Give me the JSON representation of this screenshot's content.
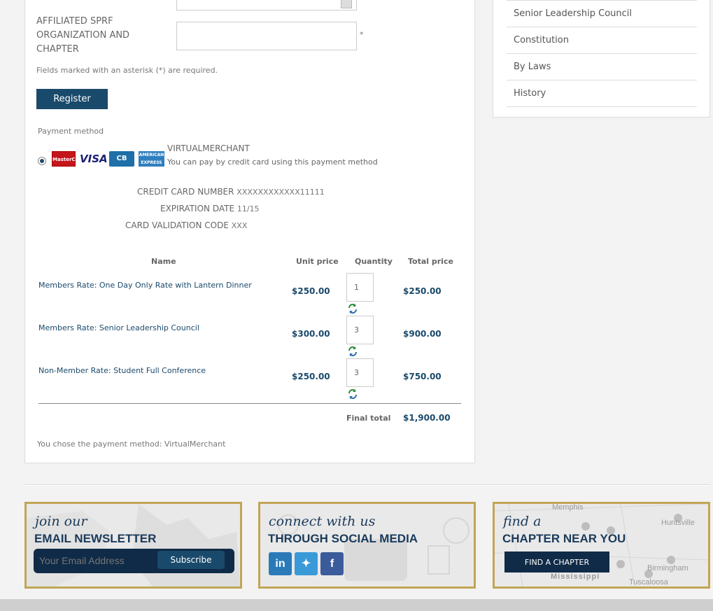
{
  "sidebar": {
    "items": [
      {
        "label": "Senior Leadership Council"
      },
      {
        "label": "Constitution"
      },
      {
        "label": "By Laws"
      },
      {
        "label": "History"
      }
    ]
  },
  "form": {
    "affiliated_label": "AFFILIATED SPRF ORGANIZATION AND CHAPTER",
    "affiliated_value": "",
    "asterisk": "*",
    "required_note": "Fields marked with an asterisk (*) are required.",
    "register_label": "Register"
  },
  "payment": {
    "method_label": "Payment method",
    "cards": [
      "MasterCard",
      "VISA",
      "CB",
      "AMERICAN EXPRESS"
    ],
    "merchant_name": "VIRTUALMERCHANT",
    "merchant_desc": "You can pay by credit card using this payment method",
    "cc_number_label": "CREDIT CARD NUMBER",
    "cc_number_value": "XXXXXXXXXXXX11111",
    "expiration_label": "EXPIRATION DATE",
    "expiration_value": "11/15",
    "cvc_label": "CARD VALIDATION CODE",
    "cvc_value": "XXX"
  },
  "order": {
    "headers": {
      "name": "Name",
      "unit_price": "Unit price",
      "quantity": "Quantity",
      "total_price": "Total price"
    },
    "rows": [
      {
        "name": "Members Rate: One Day Only Rate with Lantern Dinner",
        "unit_price": "$250.00",
        "quantity": "1",
        "total": "$250.00"
      },
      {
        "name": "Members Rate: Senior Leadership Council",
        "unit_price": "$300.00",
        "quantity": "3",
        "total": "$900.00"
      },
      {
        "name": "Non-Member Rate: Student Full Conference",
        "unit_price": "$250.00",
        "quantity": "3",
        "total": "$750.00"
      }
    ],
    "final_total_label": "Final total",
    "final_total_value": "$1,900.00",
    "chosen_method": "You chose the payment method: VirtualMerchant"
  },
  "footer": {
    "newsletter": {
      "script": "join our",
      "caps": "EMAIL NEWSLETTER",
      "placeholder": "Your Email Address",
      "subscribe_label": "Subscribe"
    },
    "social": {
      "script": "connect with us",
      "caps": "THROUGH SOCIAL MEDIA",
      "icons": [
        "linkedin-icon",
        "twitter-icon",
        "facebook-icon"
      ]
    },
    "chapter": {
      "script": "find a",
      "caps": "CHAPTER NEAR YOU",
      "button_label": "FIND A CHAPTER",
      "map_labels": [
        "Memphis",
        "Huntsville",
        "Birmingham",
        "Mississippi",
        "Tuscaloosa"
      ]
    }
  },
  "colors": {
    "brand_navy": "#1a4a6b",
    "gold_border": "#c2a555"
  }
}
